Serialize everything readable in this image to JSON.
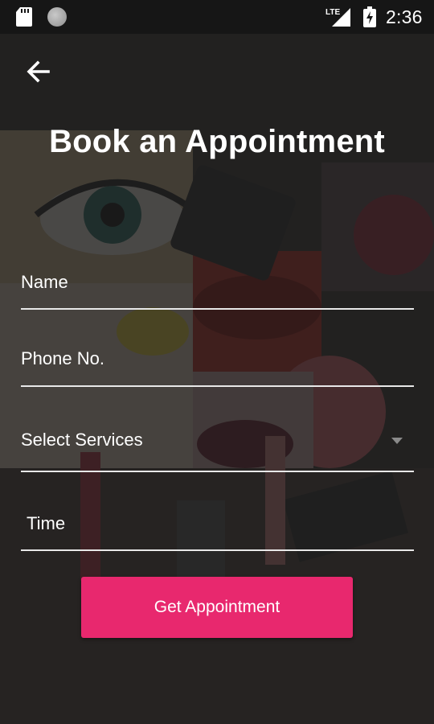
{
  "status_bar": {
    "time": "2:36",
    "network": "LTE",
    "icons": [
      "sd-card-icon",
      "circle-notification-icon",
      "lte-signal-icon",
      "battery-charging-icon"
    ]
  },
  "header": {
    "back_icon": "arrow-left-icon",
    "title": "Book an Appointment"
  },
  "form": {
    "name_label": "Name",
    "phone_label": "Phone No.",
    "services_label": "Select Services",
    "services_icon": "dropdown-arrow-icon",
    "time_label": "Time",
    "submit_label": "Get Appointment"
  },
  "colors": {
    "background": "#252525",
    "status_bar": "#161616",
    "accent": "#e8286e",
    "underline": "#e8e8e8"
  }
}
